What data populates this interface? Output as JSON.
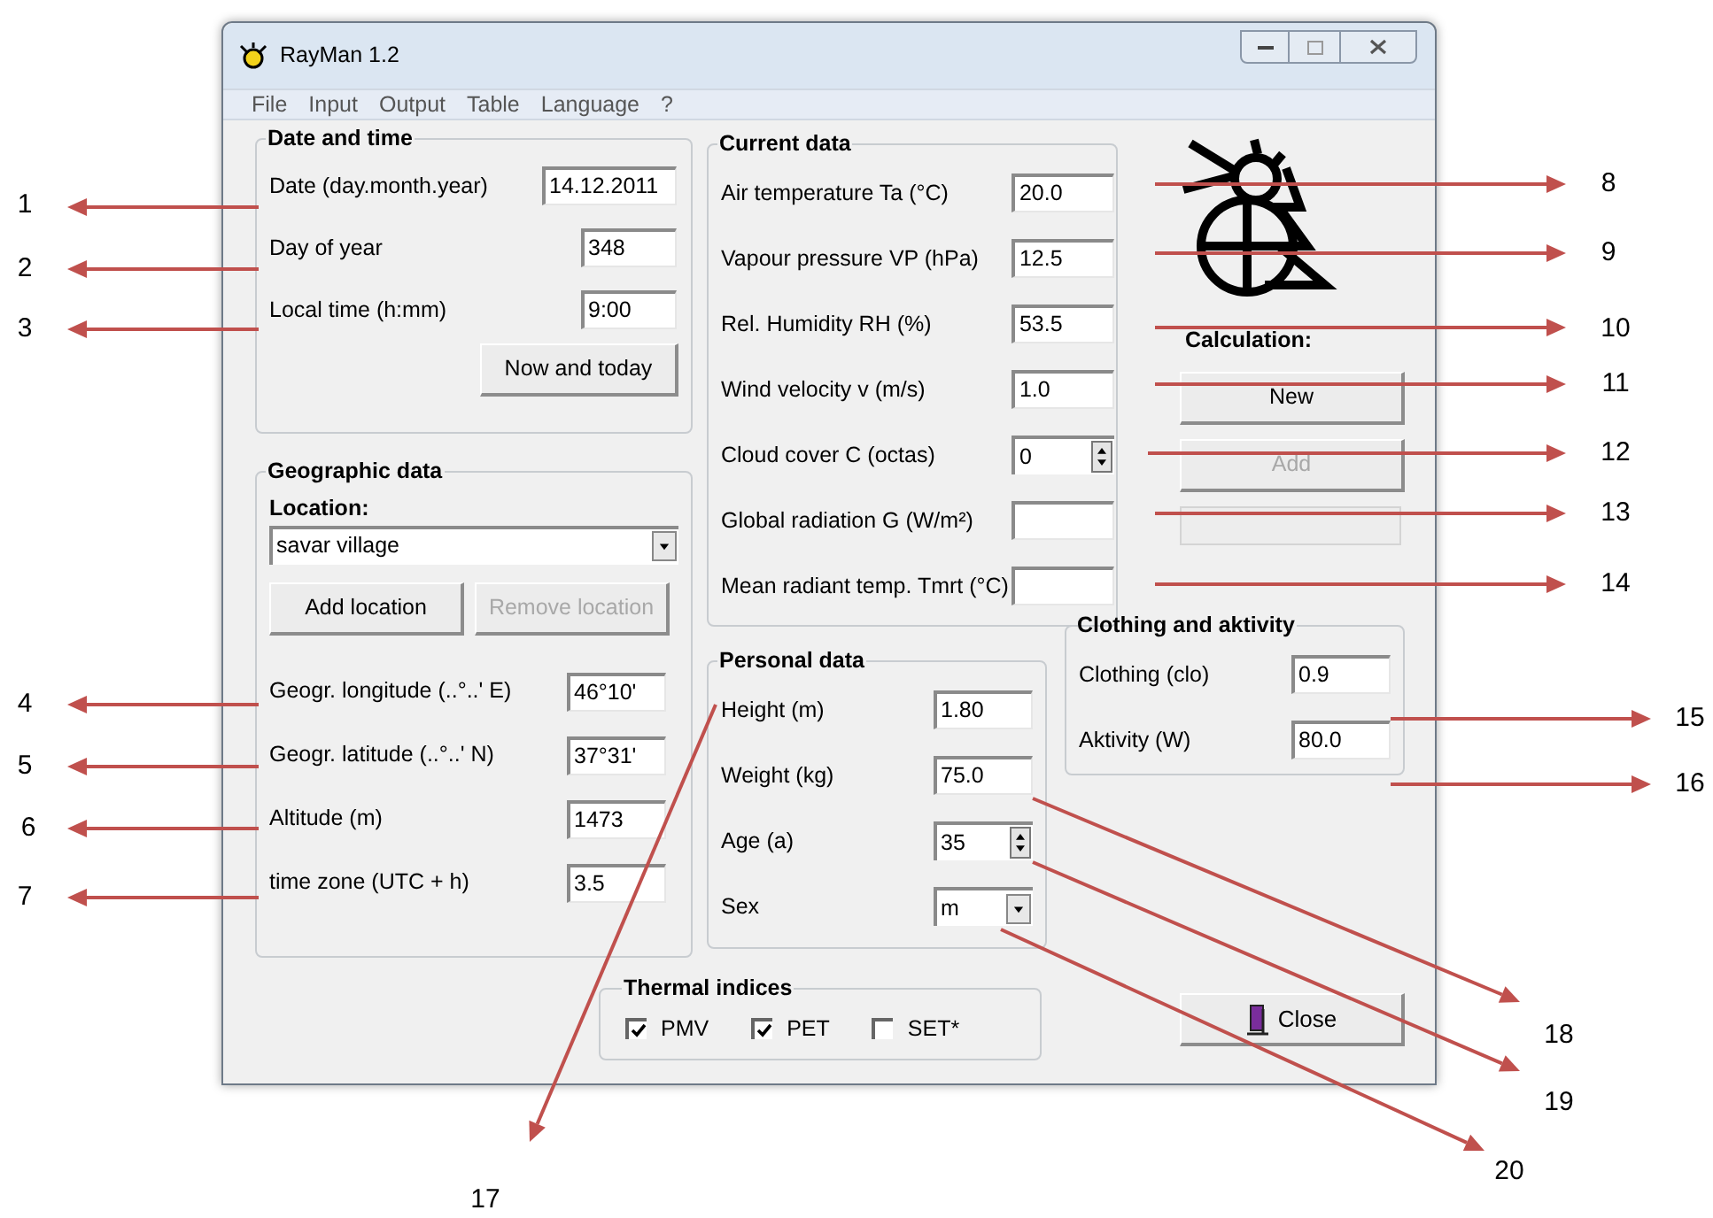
{
  "window": {
    "title": "RayMan 1.2"
  },
  "menu": [
    "File",
    "Input",
    "Output",
    "Table",
    "Language",
    "?"
  ],
  "date_and_time": {
    "title": "Date and time",
    "fields": [
      {
        "label": "Date (day.month.year)",
        "value": "14.12.2011"
      },
      {
        "label": "Day of year",
        "value": "348"
      },
      {
        "label": "Local time (h:mm)",
        "value": "9:00"
      }
    ],
    "button": "Now and today"
  },
  "geographic_data": {
    "title": "Geographic data",
    "location_label": "Location:",
    "location_value": "savar village",
    "buttons": [
      {
        "label": "Add location",
        "disabled": false
      },
      {
        "label": "Remove location",
        "disabled": true
      }
    ],
    "fields": [
      {
        "label": "Geogr. longitude (..°..' E)",
        "value": "46°10'"
      },
      {
        "label": "Geogr. latitude (..°..' N)",
        "value": "37°31'"
      },
      {
        "label": "Altitude (m)",
        "value": "1473"
      },
      {
        "label": "time zone (UTC + h)",
        "value": "3.5"
      }
    ]
  },
  "current_data": {
    "title": "Current data",
    "fields": [
      {
        "label": "Air temperature Ta (°C)",
        "value": "20.0",
        "kind": "text"
      },
      {
        "label": "Vapour pressure VP (hPa)",
        "value": "12.5",
        "kind": "text"
      },
      {
        "label": "Rel. Humidity RH (%)",
        "value": "53.5",
        "kind": "text"
      },
      {
        "label": "Wind velocity v (m/s)",
        "value": "1.0",
        "kind": "text"
      },
      {
        "label": "Cloud cover C (octas)",
        "value": "0",
        "kind": "spinner"
      },
      {
        "label": "Global radiation G (W/m²)",
        "kind": "text"
      },
      {
        "label": "Mean radiant temp. Tmrt (°C)",
        "kind": "text"
      }
    ]
  },
  "calculation": {
    "label": "Calculation:",
    "buttons": [
      {
        "label": "New",
        "disabled": false
      },
      {
        "label": "Add",
        "disabled": true
      }
    ]
  },
  "personal_data": {
    "title": "Personal data",
    "fields": [
      {
        "label": "Height (m)",
        "value": "1.80",
        "kind": "text"
      },
      {
        "label": "Weight (kg)",
        "value": "75.0",
        "kind": "text"
      },
      {
        "label": "Age (a)",
        "value": "35",
        "kind": "spinner"
      },
      {
        "label": "Sex",
        "value": "m",
        "kind": "dropdown"
      }
    ]
  },
  "clothing_and_activity": {
    "title": "Clothing and aktivity",
    "fields": [
      {
        "label": "Clothing (clo)",
        "value": "0.9"
      },
      {
        "label": "Aktivity (W)",
        "value": "80.0"
      }
    ]
  },
  "thermal_indices": {
    "title": "Thermal indices",
    "options": [
      {
        "label": "PMV",
        "checked": true
      },
      {
        "label": "PET",
        "checked": true
      },
      {
        "label": "SET*",
        "checked": false
      }
    ]
  },
  "close_button": "Close",
  "annotations": [
    {
      "label": "1"
    },
    {
      "label": "2"
    },
    {
      "label": "3"
    },
    {
      "label": "4"
    },
    {
      "label": "5"
    },
    {
      "label": "6"
    },
    {
      "label": "7"
    },
    {
      "label": "8"
    },
    {
      "label": "9"
    },
    {
      "label": "10"
    },
    {
      "label": "11"
    },
    {
      "label": "12"
    },
    {
      "label": "13"
    },
    {
      "label": "14"
    },
    {
      "label": "15"
    },
    {
      "label": "16"
    },
    {
      "label": "17"
    },
    {
      "label": "18"
    },
    {
      "label": "19"
    },
    {
      "label": "20"
    }
  ]
}
